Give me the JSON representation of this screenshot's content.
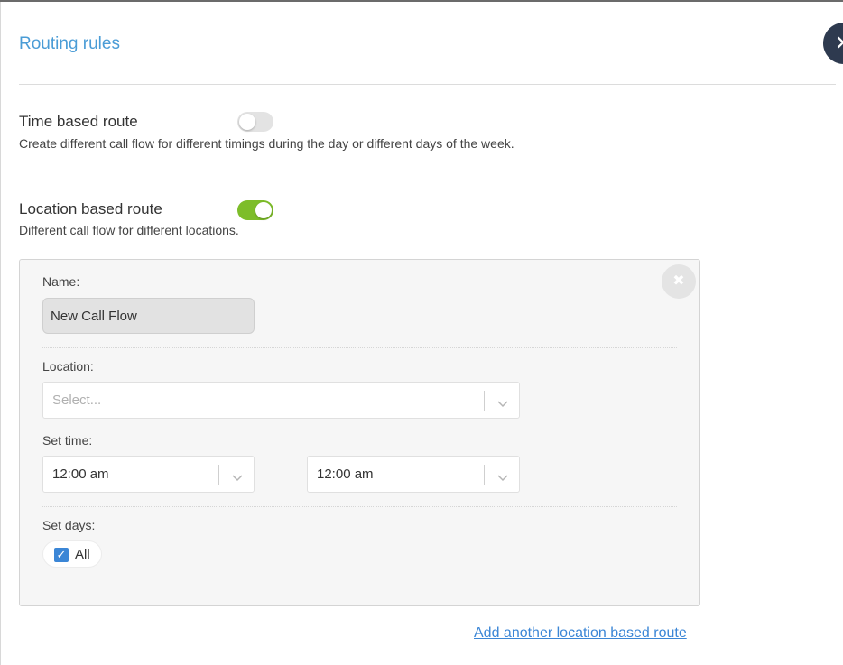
{
  "header": {
    "title": "Routing rules"
  },
  "time_route": {
    "title": "Time based route",
    "description": "Create different call flow for different timings during the day or different days of the week.",
    "enabled": false
  },
  "location_route": {
    "title": "Location based route",
    "description": "Different call flow for different locations.",
    "enabled": true
  },
  "card": {
    "name_label": "Name:",
    "name_value": "New Call Flow",
    "location_label": "Location:",
    "location_placeholder": "Select...",
    "set_time_label": "Set time:",
    "start_time": "12:00 am",
    "end_time": "12:00 am",
    "set_days_label": "Set days:",
    "days_all_label": "All",
    "days_all_checked": true
  },
  "add_link": "Add another location based route",
  "colors": {
    "accent_blue": "#4a9cd6",
    "link_blue": "#3b86d6",
    "toggle_on": "#7dbd29",
    "dark_circle": "#2e3a4f"
  }
}
